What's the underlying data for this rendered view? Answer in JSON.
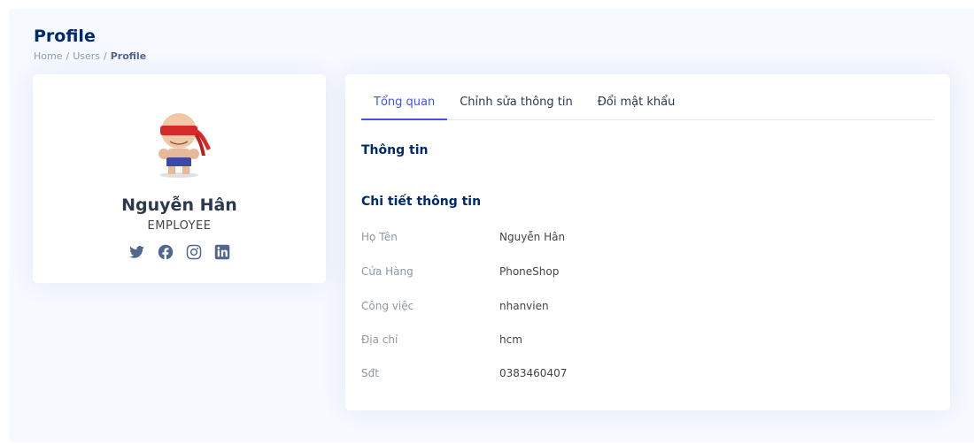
{
  "page": {
    "title": "Profile",
    "breadcrumb": [
      "Home",
      "Users",
      "Profile"
    ]
  },
  "profile": {
    "name": "Nguyễn Hân",
    "role": "EMPLOYEE",
    "social": [
      "twitter-icon",
      "facebook-icon",
      "instagram-icon",
      "linkedin-icon"
    ]
  },
  "tabs": [
    "Tổng quan",
    "Chỉnh sửa thông tin",
    "Đổi mật khẩu"
  ],
  "overview": {
    "section_title": "Thông tin",
    "details_title": "Chi tiết thông tin",
    "rows": [
      {
        "label": "Họ Tên",
        "value": "Nguyễn Hân"
      },
      {
        "label": "Cửa Hàng",
        "value": "PhoneShop"
      },
      {
        "label": "Công việc",
        "value": "nhanvien"
      },
      {
        "label": "Địa chỉ",
        "value": "hcm"
      },
      {
        "label": "Sđt",
        "value": "0383460407"
      }
    ]
  },
  "colors": {
    "accent": "#4154f1",
    "heading": "#012970",
    "background": "#f6f9ff"
  }
}
